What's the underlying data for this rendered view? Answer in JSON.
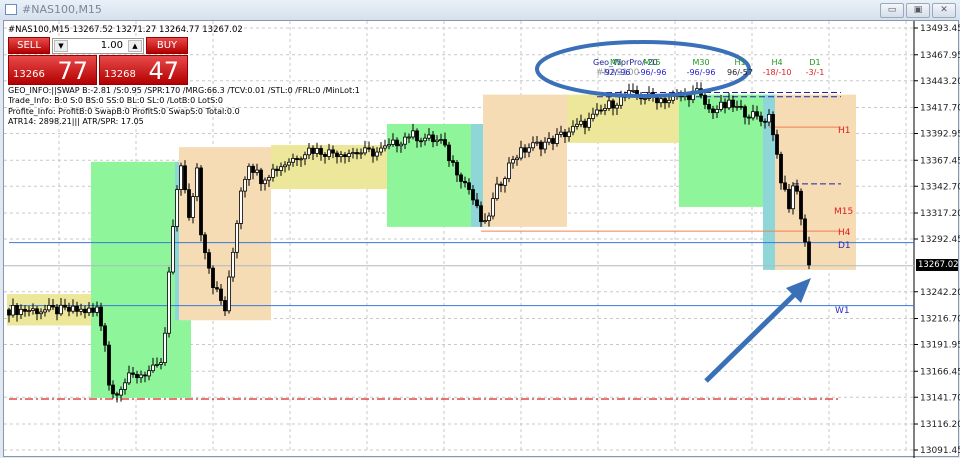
{
  "window": {
    "title": "#NAS100,M15"
  },
  "header": {
    "symbol_line": "#NAS100,M15  13267.52 13271.27 13264.77 13267.02"
  },
  "trade_panel": {
    "sell_label": "SELL",
    "buy_label": "BUY",
    "lot": "1.00",
    "sell_prefix": "13266",
    "sell_big": "77",
    "buy_prefix": "13268",
    "buy_big": "47"
  },
  "info_lines": [
    "GEO_INFO:||SWAP B:-2.81 /S:0.95 /SPR:170 /MRG:66.3 /TCV:0.01 /STL:0 /FRL:0 /MinLot:1",
    "Trade_Info: B:0 S:0 BS:0 SS:0 BL:0 SL:0 /LotB:0 LotS:0",
    "Profite_Info: ProfitB:0 SwapB:0 ProfitS:0 SwapS:0 Total:0.0",
    "ATR14: 2898.21||| ATR/SPR: 17.05"
  ],
  "indicator": {
    "name": "Geo_WprPro/-20",
    "symbol": "#NAS100",
    "timeframes": [
      {
        "tf": "M5",
        "value": "-92/-96",
        "color": "#2222cc"
      },
      {
        "tf": "M15",
        "value": "-96/-96",
        "color": "#2222cc"
      },
      {
        "tf": "M30",
        "value": "-96/-96",
        "color": "#2222cc"
      },
      {
        "tf": "H1",
        "value": "96/-57",
        "color": "#222222"
      },
      {
        "tf": "H4",
        "value": "-18/-10",
        "color": "#e02020"
      },
      {
        "tf": "D1",
        "value": "-3/-1",
        "color": "#e02020"
      }
    ]
  },
  "chart_data": {
    "type": "candlestick",
    "symbol": "#NAS100",
    "timeframe": "M15",
    "ylim": [
      13091.45,
      13493.45
    ],
    "y_ticks": [
      "13493.45",
      "13467.95",
      "13443.20",
      "13417.70",
      "13392.95",
      "13367.45",
      "13342.70",
      "13317.20",
      "13292.45",
      "13242.20",
      "13216.70",
      "13191.95",
      "13166.45",
      "13141.70",
      "13116.20",
      "13091.45"
    ],
    "current_price": "13267.02",
    "bars": 201,
    "close_path": [
      [
        0,
        13225
      ],
      [
        20,
        13224
      ],
      [
        21,
        13222
      ],
      [
        22,
        13226
      ],
      [
        24,
        13195
      ],
      [
        25,
        13155
      ],
      [
        26,
        13145
      ],
      [
        30,
        13160
      ],
      [
        38,
        13170
      ],
      [
        40,
        13185
      ],
      [
        38,
        13175
      ],
      [
        39,
        13200
      ],
      [
        40,
        13260
      ],
      [
        42,
        13340
      ],
      [
        43,
        13365
      ],
      [
        45,
        13310
      ],
      [
        47,
        13360
      ],
      [
        48,
        13300
      ],
      [
        51,
        13250
      ],
      [
        54,
        13225
      ],
      [
        56,
        13280
      ],
      [
        58,
        13340
      ],
      [
        60,
        13365
      ],
      [
        63,
        13350
      ],
      [
        66,
        13358
      ],
      [
        75,
        13378
      ],
      [
        80,
        13375
      ],
      [
        92,
        13375
      ],
      [
        95,
        13380
      ],
      [
        100,
        13392
      ],
      [
        108,
        13385
      ],
      [
        110,
        13370
      ],
      [
        115,
        13340
      ],
      [
        118,
        13310
      ],
      [
        119,
        13305
      ],
      [
        122,
        13340
      ],
      [
        126,
        13370
      ],
      [
        130,
        13380
      ],
      [
        135,
        13385
      ],
      [
        140,
        13395
      ],
      [
        145,
        13405
      ],
      [
        150,
        13420
      ],
      [
        155,
        13430
      ],
      [
        165,
        13425
      ],
      [
        172,
        13432
      ],
      [
        175,
        13415
      ],
      [
        180,
        13420
      ],
      [
        185,
        13412
      ],
      [
        188,
        13405
      ],
      [
        190,
        13410
      ],
      [
        191,
        13395
      ],
      [
        193,
        13350
      ],
      [
        195,
        13320
      ],
      [
        196,
        13345
      ],
      [
        197,
        13335
      ],
      [
        198,
        13315
      ],
      [
        199,
        13290
      ],
      [
        200,
        13267
      ]
    ],
    "zones": [
      {
        "type": "yellow",
        "from": 0,
        "to": 21,
        "low": 13210,
        "high": 13240
      },
      {
        "type": "green",
        "from": 21,
        "to": 45,
        "low": 13141,
        "high": 13366
      },
      {
        "type": "cyan",
        "from": 42,
        "to": 45,
        "low": 13215,
        "high": 13366
      },
      {
        "type": "orange",
        "from": 43,
        "to": 65,
        "low": 13215,
        "high": 13380
      },
      {
        "type": "yellow",
        "from": 66,
        "to": 94,
        "low": 13340,
        "high": 13382
      },
      {
        "type": "green",
        "from": 95,
        "to": 116,
        "low": 13304,
        "high": 13402
      },
      {
        "type": "cyan",
        "from": 116,
        "to": 119,
        "low": 13304,
        "high": 13402
      },
      {
        "type": "orange",
        "from": 119,
        "to": 139,
        "low": 13304,
        "high": 13430
      },
      {
        "type": "yellow",
        "from": 140,
        "to": 168,
        "low": 13384,
        "high": 13430
      },
      {
        "type": "green",
        "from": 168,
        "to": 189,
        "low": 13323,
        "high": 13430
      },
      {
        "type": "cyan",
        "from": 189,
        "to": 192,
        "low": 13263,
        "high": 13430
      },
      {
        "type": "orange",
        "from": 192,
        "to": 212,
        "low": 13263,
        "high": 13430
      }
    ],
    "levels": [
      {
        "label": "D1",
        "price": 13289,
        "color": "#3a78d8",
        "style": "solid",
        "from": 0,
        "label_color": "#2a2ad0"
      },
      {
        "label": "W1",
        "price": 13229,
        "color": "#3a78d8",
        "style": "solid",
        "from": 0,
        "label_color": "#2a2ad0"
      },
      {
        "label": "H1",
        "price": 13399,
        "color": "#f08050",
        "style": "solid",
        "from": 190,
        "label_color": "#e02020"
      },
      {
        "label": "H4",
        "price": 13300,
        "color": "#f08050",
        "style": "solid",
        "from": 118,
        "label_color": "#e02020"
      },
      {
        "label": "M15",
        "price": 13320,
        "color": "#f08050",
        "style": "none",
        "from": 196,
        "label_color": "#e02020"
      },
      {
        "label": "",
        "price": 13140,
        "color": "#e02020",
        "style": "dashdot",
        "from": 0,
        "label_color": ""
      },
      {
        "label": "",
        "price": 13432,
        "color": "#2020a0",
        "style": "dashed",
        "from": 147,
        "label_color": ""
      },
      {
        "label": "",
        "price": 13428,
        "color": "#2020a0",
        "style": "dashed",
        "from": 147,
        "label_color": ""
      },
      {
        "label": "",
        "price": 13345,
        "color": "#2020a0",
        "style": "dashed",
        "from": 196,
        "label_color": ""
      }
    ]
  },
  "colors": {
    "yellow": "#ece79a",
    "green": "#8ef59a",
    "cyan": "#8fd6d9",
    "orange": "#f5dcb4",
    "annotation": "#3a70b8"
  }
}
